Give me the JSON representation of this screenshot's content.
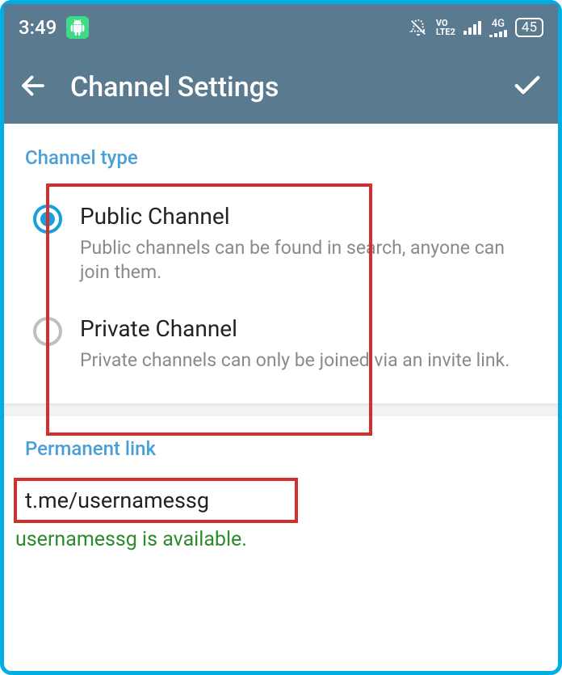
{
  "status_bar": {
    "time": "3:49",
    "volte": "VO\nLTE2",
    "network": "4G",
    "battery": "45"
  },
  "header": {
    "title": "Channel Settings"
  },
  "sections": {
    "channel_type": {
      "heading": "Channel type",
      "options": [
        {
          "label": "Public Channel",
          "description": "Public channels can be found in search, anyone can join them.",
          "selected": true
        },
        {
          "label": "Private Channel",
          "description": "Private channels can only be joined via an invite link.",
          "selected": false
        }
      ]
    },
    "permanent_link": {
      "heading": "Permanent link",
      "value": "t.me/usernamessg",
      "status": "usernamessg is available."
    }
  }
}
